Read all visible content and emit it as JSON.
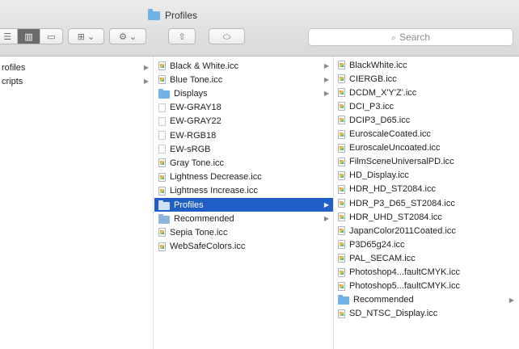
{
  "window": {
    "title": "Profiles"
  },
  "toolbar": {
    "view_icons": [
      "list-view-icon",
      "columns-view-icon",
      "cover-flow-view-icon"
    ],
    "group_icon": "group-icon",
    "action_icon": "gear-icon",
    "share_icon": "share-icon",
    "tags_icon": "tag-icon",
    "dropdown_glyph": "⌄",
    "search_placeholder": "Search"
  },
  "columns": [
    {
      "items": [
        {
          "label": "rofiles",
          "icon": "none",
          "arrow": true,
          "selected": false
        },
        {
          "label": "cripts",
          "icon": "none",
          "arrow": true,
          "selected": false
        }
      ]
    },
    {
      "items": [
        {
          "label": "Black & White.icc",
          "icon": "icc",
          "arrow": true,
          "selected": false
        },
        {
          "label": "Blue Tone.icc",
          "icon": "icc",
          "arrow": true,
          "selected": false
        },
        {
          "label": "Displays",
          "icon": "folder",
          "arrow": true,
          "selected": false
        },
        {
          "label": "EW-GRAY18",
          "icon": "doc",
          "arrow": false,
          "selected": false
        },
        {
          "label": "EW-GRAY22",
          "icon": "doc",
          "arrow": false,
          "selected": false
        },
        {
          "label": "EW-RGB18",
          "icon": "doc",
          "arrow": false,
          "selected": false
        },
        {
          "label": "EW-sRGB",
          "icon": "doc",
          "arrow": false,
          "selected": false
        },
        {
          "label": "Gray Tone.icc",
          "icon": "icc",
          "arrow": false,
          "selected": false
        },
        {
          "label": "Lightness Decrease.icc",
          "icon": "icc",
          "arrow": false,
          "selected": false
        },
        {
          "label": "Lightness Increase.icc",
          "icon": "icc",
          "arrow": false,
          "selected": false
        },
        {
          "label": "Profiles",
          "icon": "folder",
          "arrow": true,
          "selected": true
        },
        {
          "label": "Recommended",
          "icon": "smartfolder",
          "arrow": true,
          "selected": false
        },
        {
          "label": "Sepia Tone.icc",
          "icon": "icc",
          "arrow": false,
          "selected": false
        },
        {
          "label": "WebSafeColors.icc",
          "icon": "icc",
          "arrow": false,
          "selected": false
        }
      ]
    },
    {
      "items": [
        {
          "label": "BlackWhite.icc",
          "icon": "icc",
          "arrow": false,
          "selected": false
        },
        {
          "label": "CIERGB.icc",
          "icon": "icc",
          "arrow": false,
          "selected": false
        },
        {
          "label": "DCDM_X'Y'Z'.icc",
          "icon": "icc",
          "arrow": false,
          "selected": false
        },
        {
          "label": "DCI_P3.icc",
          "icon": "icc",
          "arrow": false,
          "selected": false
        },
        {
          "label": "DCIP3_D65.icc",
          "icon": "icc",
          "arrow": false,
          "selected": false
        },
        {
          "label": "EuroscaleCoated.icc",
          "icon": "icc",
          "arrow": false,
          "selected": false
        },
        {
          "label": "EuroscaleUncoated.icc",
          "icon": "icc",
          "arrow": false,
          "selected": false
        },
        {
          "label": "FilmSceneUniversalPD.icc",
          "icon": "icc",
          "arrow": false,
          "selected": false
        },
        {
          "label": "HD_Display.icc",
          "icon": "icc",
          "arrow": false,
          "selected": false
        },
        {
          "label": "HDR_HD_ST2084.icc",
          "icon": "icc",
          "arrow": false,
          "selected": false
        },
        {
          "label": "HDR_P3_D65_ST2084.icc",
          "icon": "icc",
          "arrow": false,
          "selected": false
        },
        {
          "label": "HDR_UHD_ST2084.icc",
          "icon": "icc",
          "arrow": false,
          "selected": false
        },
        {
          "label": "JapanColor2011Coated.icc",
          "icon": "icc",
          "arrow": false,
          "selected": false
        },
        {
          "label": "P3D65g24.icc",
          "icon": "icc",
          "arrow": false,
          "selected": false
        },
        {
          "label": "PAL_SECAM.icc",
          "icon": "icc",
          "arrow": false,
          "selected": false
        },
        {
          "label": "Photoshop4...faultCMYK.icc",
          "icon": "icc",
          "arrow": false,
          "selected": false
        },
        {
          "label": "Photoshop5...faultCMYK.icc",
          "icon": "icc",
          "arrow": false,
          "selected": false
        },
        {
          "label": "Recommended",
          "icon": "folder",
          "arrow": true,
          "selected": false
        },
        {
          "label": "SD_NTSC_Display.icc",
          "icon": "icc",
          "arrow": false,
          "selected": false
        }
      ]
    }
  ],
  "colors": {
    "selection": "#1f5fc7",
    "folder": "#6fb2e6"
  }
}
